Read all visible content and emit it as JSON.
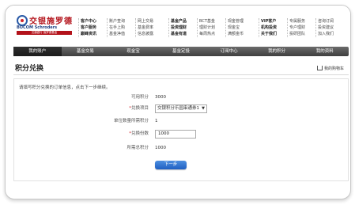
{
  "brand": {
    "name_cn": "交银施罗德",
    "name_en": "BOCOM Schroders",
    "tagline": "交通银行 施罗德基金"
  },
  "topnav": {
    "columns": [
      [
        "客户中心",
        "客户服务",
        "巅峰资讯"
      ],
      [
        "账户查询",
        "在手上购",
        "基金净值"
      ],
      [
        "网上交易",
        "基金费率",
        "信息披露"
      ],
      [
        "基金产品",
        "投资理财",
        "基金有道"
      ],
      [
        "BCT基金",
        "理财计划",
        "每周热点"
      ],
      [
        "现金管理",
        "现金宝",
        "满额金币"
      ],
      [
        "VIP客户",
        "机构投资",
        "关于我们"
      ],
      [
        "专属服务",
        "专户理财",
        "投研团队"
      ],
      [
        "咨询订阅",
        "投资建议",
        "加入我们"
      ]
    ]
  },
  "tabs": [
    "我的账户",
    "基金交易",
    "现金宝",
    "基金定投",
    "订阅中心",
    "我的积分",
    "我的资料"
  ],
  "active_tab": 0,
  "page": {
    "title": "积分兑换",
    "cart_label": "我的购物车"
  },
  "form": {
    "intro": "请填写积分兑换的订单信息，点击下一步继续。",
    "available_points_label": "可用积分",
    "available_points_value": "3000",
    "item_label": "兑换项目",
    "item_value": "交银积分乐园串通券1",
    "unit_points_label": "单位数量所需积分",
    "unit_points_value": "1",
    "quantity_label": "兑换份数",
    "quantity_value": "1000",
    "total_points_label": "所需总积分",
    "total_points_value": "1000",
    "required_mark": "*",
    "next_button": "下一步"
  }
}
